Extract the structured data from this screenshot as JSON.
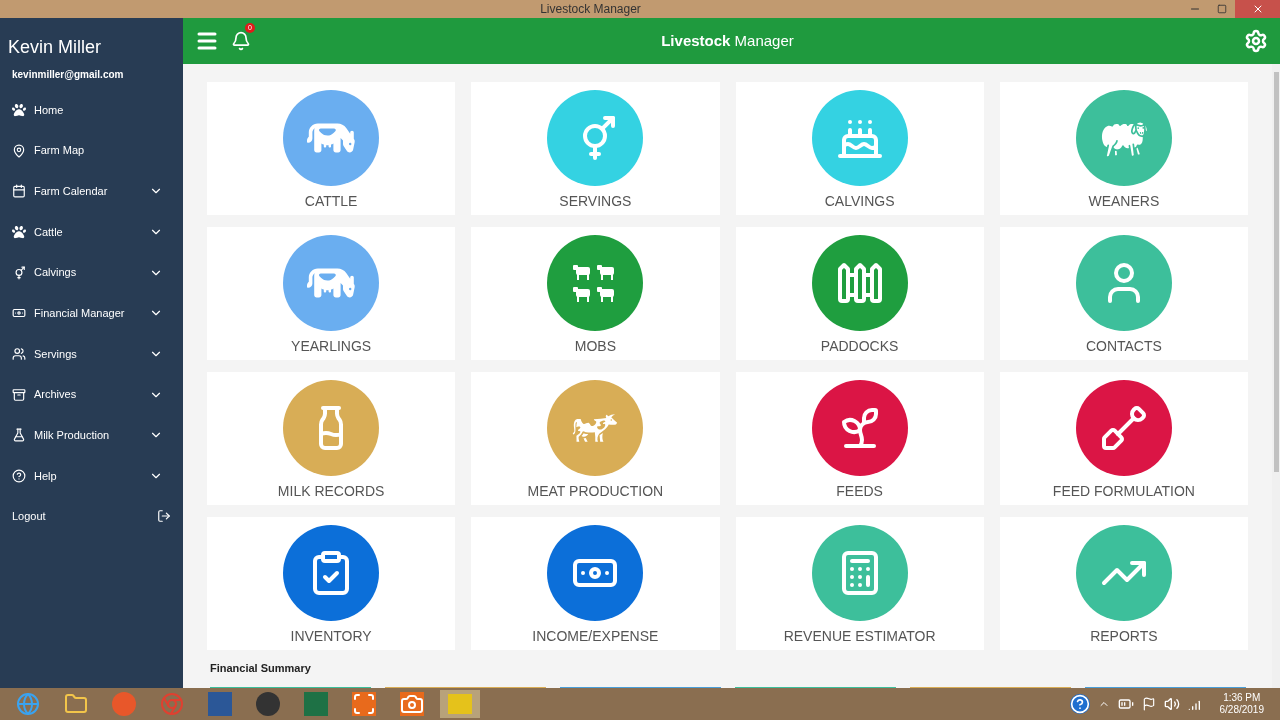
{
  "window": {
    "title": "Livestock Manager"
  },
  "user": {
    "name": "Kevin Miller",
    "email": "kevinmiller@gmail.com"
  },
  "sidebar": {
    "items": [
      {
        "label": "Home",
        "kind": "link"
      },
      {
        "label": "Farm Map",
        "kind": "link"
      },
      {
        "label": "Farm Calendar",
        "kind": "menu",
        "expanded": false
      },
      {
        "label": "Cattle",
        "kind": "menu",
        "expanded": false
      },
      {
        "label": "Calvings",
        "kind": "menu",
        "expanded": false
      },
      {
        "label": "Financial Manager",
        "kind": "menu",
        "expanded": false
      },
      {
        "label": "Servings",
        "kind": "menu",
        "expanded": false
      },
      {
        "label": "Archives",
        "kind": "menu",
        "expanded": false
      },
      {
        "label": "Milk Production",
        "kind": "menu",
        "expanded": false
      },
      {
        "label": "Help",
        "kind": "menu",
        "expanded": false
      },
      {
        "label": "Logout",
        "kind": "logout"
      }
    ]
  },
  "header": {
    "title": "**Livestock** Manager",
    "notifications": "0"
  },
  "tiles": [
    {
      "label": "CATTLE",
      "color": "#6aaef0"
    },
    {
      "label": "SERVINGS",
      "color": "#34d2e2"
    },
    {
      "label": "CALVINGS",
      "color": "#34d2e2"
    },
    {
      "label": "WEANERS",
      "color": "#3dbf9b"
    },
    {
      "label": "YEARLINGS",
      "color": "#6aaef0"
    },
    {
      "label": "MOBS",
      "color": "#1f9e3f"
    },
    {
      "label": "PADDOCKS",
      "color": "#1f9e3f"
    },
    {
      "label": "CONTACTS",
      "color": "#3dbf9b"
    },
    {
      "label": "MILK RECORDS",
      "color": "#d8ad56"
    },
    {
      "label": "MEAT PRODUCTION",
      "color": "#d8ad56"
    },
    {
      "label": "FEEDS",
      "color": "#db1545"
    },
    {
      "label": "FEED FORMULATION",
      "color": "#db1545"
    },
    {
      "label": "INVENTORY",
      "color": "#0c6fd9"
    },
    {
      "label": "INCOME/EXPENSE",
      "color": "#0c6fd9"
    },
    {
      "label": "REVENUE ESTIMATOR",
      "color": "#3dbf9b"
    },
    {
      "label": "REPORTS",
      "color": "#3dbf9b"
    }
  ],
  "financial_summary": {
    "title": "Financial Summary",
    "cards": [
      {
        "color": "#3dbf9b"
      },
      {
        "color": "#d8ad56"
      },
      {
        "color": "#4a9fd8"
      },
      {
        "color": "#3dbf9b"
      },
      {
        "color": "#d8ad56"
      },
      {
        "color": "#4a9fd8"
      }
    ]
  },
  "taskbar": {
    "time": "1:36 PM",
    "date": "6/28/2019"
  }
}
